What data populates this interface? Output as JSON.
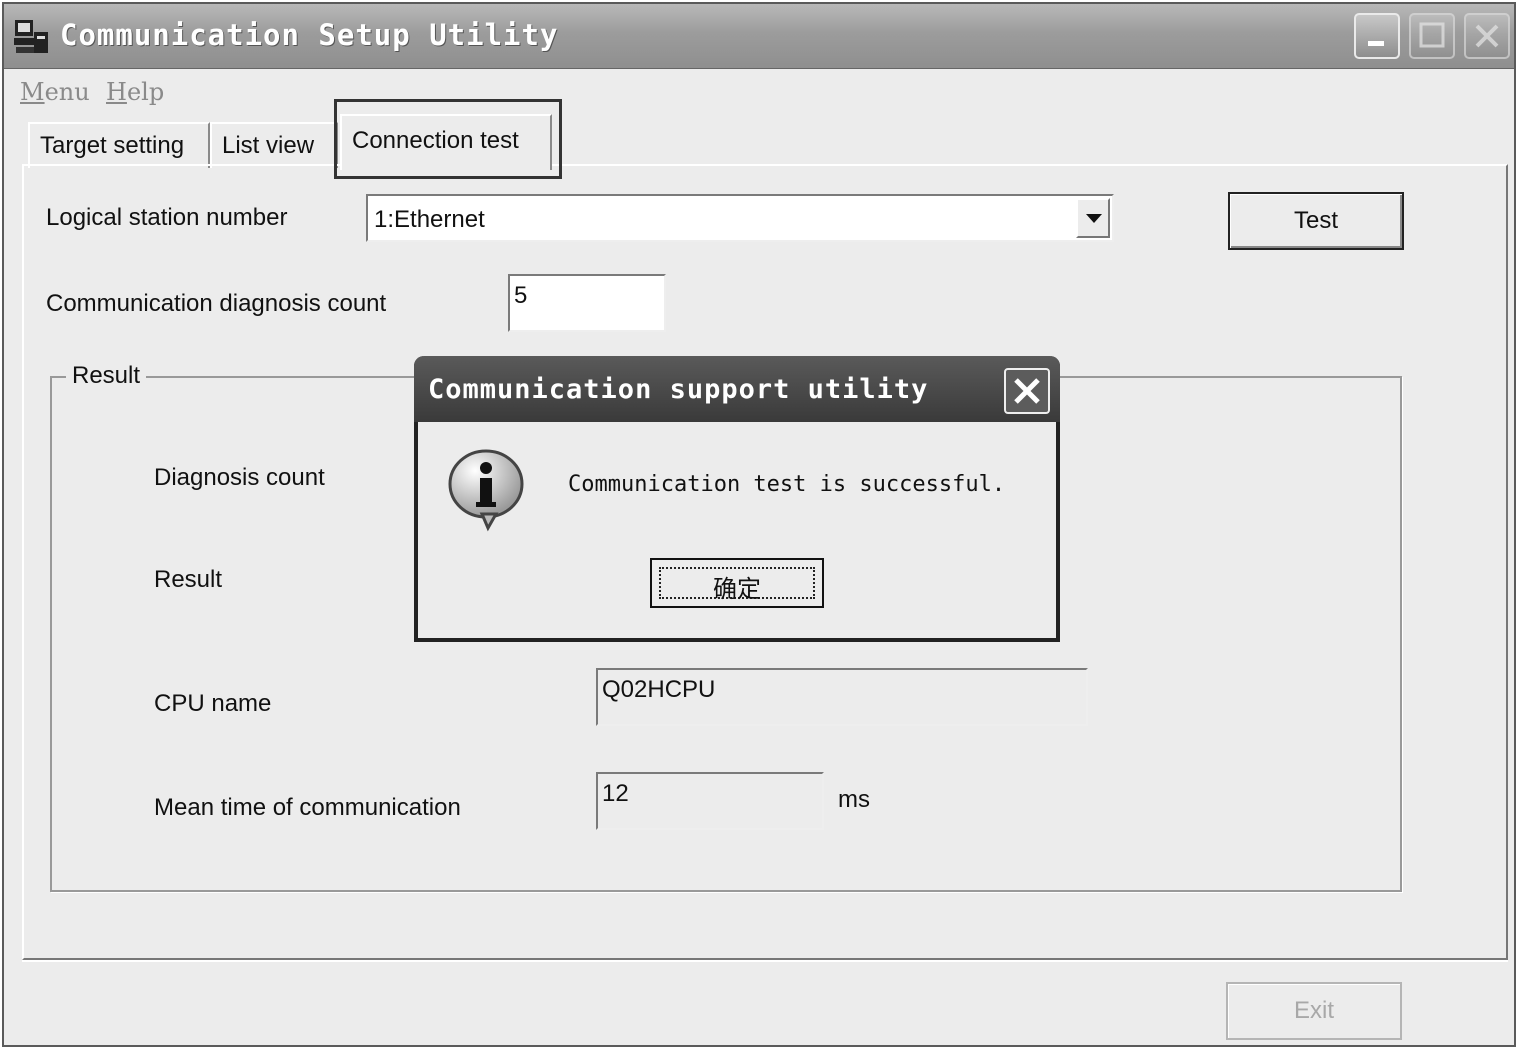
{
  "window": {
    "title": "Communication Setup Utility"
  },
  "menu": {
    "items": [
      "Menu",
      "Help"
    ]
  },
  "tabs": [
    {
      "label": "Target setting",
      "active": false
    },
    {
      "label": "List view",
      "active": false
    },
    {
      "label": "Connection test",
      "active": true
    }
  ],
  "form": {
    "logical_station_label": "Logical station number",
    "logical_station_value": "1:Ethernet",
    "diag_count_label": "Communication diagnosis count",
    "diag_count_value": "5",
    "test_button": "Test"
  },
  "result": {
    "group_title": "Result",
    "diagnosis_count_label": "Diagnosis count",
    "result_label": "Result",
    "cpu_name_label": "CPU name",
    "cpu_name_value": "Q02HCPU",
    "mean_time_label": "Mean time of communication",
    "mean_time_value": "12",
    "mean_time_unit": "ms"
  },
  "footer": {
    "exit_button": "Exit"
  },
  "dialog": {
    "title": "Communication support utility",
    "message": "Communication test is successful.",
    "ok_button": "确定",
    "icon": "info-icon"
  }
}
